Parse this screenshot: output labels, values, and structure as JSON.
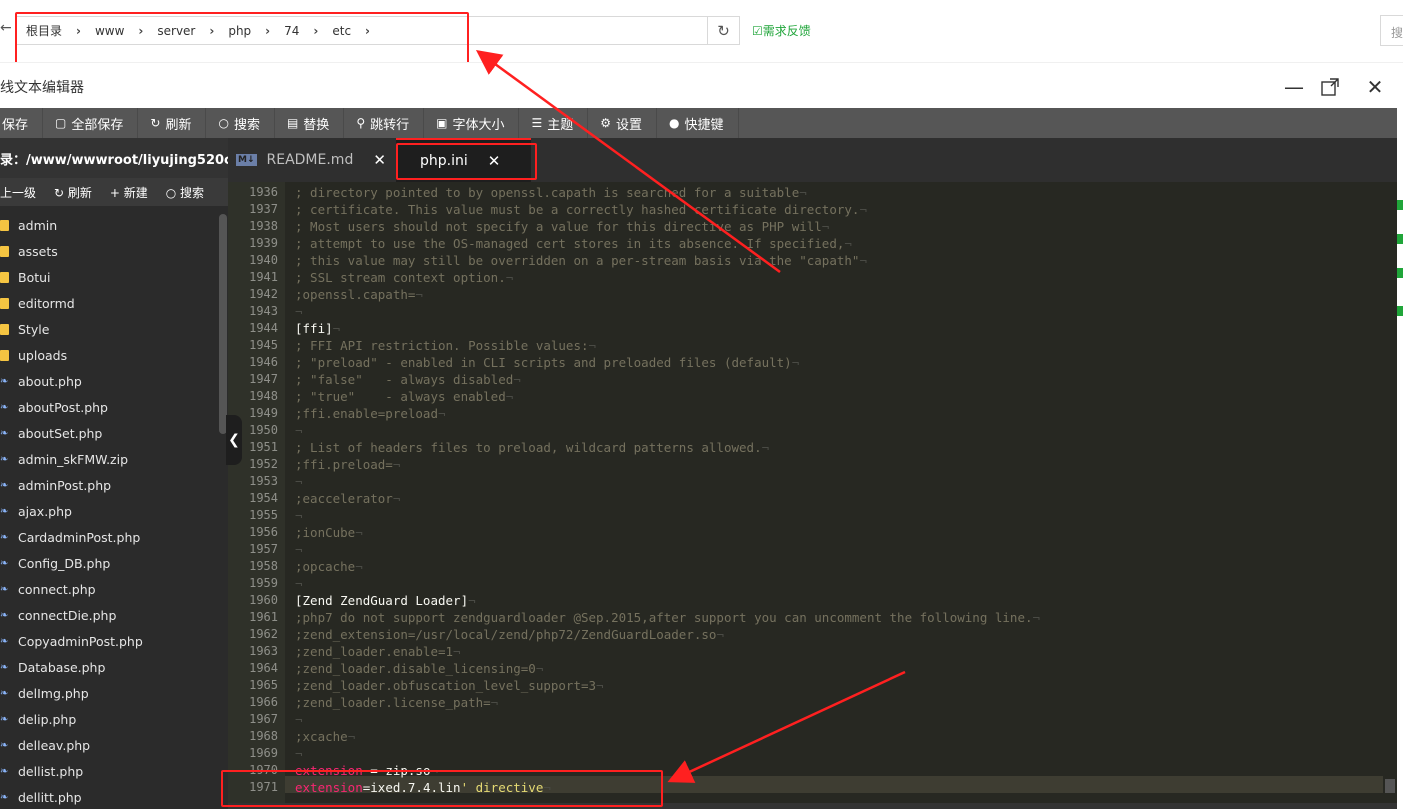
{
  "breadcrumb": [
    "根目录",
    "www",
    "server",
    "php",
    "74",
    "etc"
  ],
  "feedback_label": "需求反馈",
  "search_placeholder": "搜",
  "dialog_title": "线文本编辑器",
  "toolbar": [
    {
      "icon": "save-icon",
      "label": "保存"
    },
    {
      "icon": "save-all-icon",
      "label": "全部保存"
    },
    {
      "icon": "refresh-icon",
      "label": "刷新"
    },
    {
      "icon": "search-icon",
      "label": "搜索"
    },
    {
      "icon": "replace-icon",
      "label": "替换"
    },
    {
      "icon": "goto-line-icon",
      "label": "跳转行"
    },
    {
      "icon": "font-size-icon",
      "label": "字体大小"
    },
    {
      "icon": "theme-icon",
      "label": "主题"
    },
    {
      "icon": "settings-icon",
      "label": "设置"
    },
    {
      "icon": "shortcut-icon",
      "label": "快捷键"
    }
  ],
  "file_panel": {
    "dir_label": "录：/www/wwwroot/liyujing520c...",
    "actions": [
      "上一级",
      "刷新",
      "新建",
      "搜索"
    ],
    "files": [
      {
        "name": "admin",
        "type": "folder"
      },
      {
        "name": "assets",
        "type": "folder"
      },
      {
        "name": "Botui",
        "type": "folder"
      },
      {
        "name": "editormd",
        "type": "folder"
      },
      {
        "name": "Style",
        "type": "folder"
      },
      {
        "name": "uploads",
        "type": "folder"
      },
      {
        "name": "about.php",
        "type": "file"
      },
      {
        "name": "aboutPost.php",
        "type": "file"
      },
      {
        "name": "aboutSet.php",
        "type": "file"
      },
      {
        "name": "admin_skFMW.zip",
        "type": "file"
      },
      {
        "name": "adminPost.php",
        "type": "file"
      },
      {
        "name": "ajax.php",
        "type": "file"
      },
      {
        "name": "CardadminPost.php",
        "type": "file"
      },
      {
        "name": "Config_DB.php",
        "type": "file"
      },
      {
        "name": "connect.php",
        "type": "file"
      },
      {
        "name": "connectDie.php",
        "type": "file"
      },
      {
        "name": "CopyadminPost.php",
        "type": "file"
      },
      {
        "name": "Database.php",
        "type": "file"
      },
      {
        "name": "delImg.php",
        "type": "file"
      },
      {
        "name": "delip.php",
        "type": "file"
      },
      {
        "name": "delleav.php",
        "type": "file"
      },
      {
        "name": "dellist.php",
        "type": "file"
      },
      {
        "name": "dellitt.php",
        "type": "file"
      }
    ]
  },
  "tabs": [
    {
      "label": "README.md",
      "active": false
    },
    {
      "label": "php.ini",
      "active": true
    }
  ],
  "code_lines": [
    {
      "n": "1936",
      "t": "; directory pointed to by openssl.capath is searched for a suitable",
      "k": "comment"
    },
    {
      "n": "1937",
      "t": "; certificate. This value must be a correctly hashed certificate directory.",
      "k": "comment"
    },
    {
      "n": "1938",
      "t": "; Most users should not specify a value for this directive as PHP will",
      "k": "comment"
    },
    {
      "n": "1939",
      "t": "; attempt to use the OS-managed cert stores in its absence. If specified,",
      "k": "comment"
    },
    {
      "n": "1940",
      "t": "; this value may still be overridden on a per-stream basis via the \"capath\"",
      "k": "comment"
    },
    {
      "n": "1941",
      "t": "; SSL stream context option.",
      "k": "comment"
    },
    {
      "n": "1942",
      "t": ";openssl.capath=",
      "k": "comment"
    },
    {
      "n": "1943",
      "t": "",
      "k": "comment"
    },
    {
      "n": "1944",
      "t": "[ffi]",
      "k": "section"
    },
    {
      "n": "1945",
      "t": "; FFI API restriction. Possible values:",
      "k": "comment"
    },
    {
      "n": "1946",
      "t": "; \"preload\" - enabled in CLI scripts and preloaded files (default)",
      "k": "comment"
    },
    {
      "n": "1947",
      "t": "; \"false\"   - always disabled",
      "k": "comment"
    },
    {
      "n": "1948",
      "t": "; \"true\"    - always enabled",
      "k": "comment"
    },
    {
      "n": "1949",
      "t": ";ffi.enable=preload",
      "k": "comment"
    },
    {
      "n": "1950",
      "t": "",
      "k": "comment"
    },
    {
      "n": "1951",
      "t": "; List of headers files to preload, wildcard patterns allowed.",
      "k": "comment"
    },
    {
      "n": "1952",
      "t": ";ffi.preload=",
      "k": "comment"
    },
    {
      "n": "1953",
      "t": "",
      "k": "comment"
    },
    {
      "n": "1954",
      "t": ";eaccelerator",
      "k": "comment"
    },
    {
      "n": "1955",
      "t": "",
      "k": "comment"
    },
    {
      "n": "1956",
      "t": ";ionCube",
      "k": "comment"
    },
    {
      "n": "1957",
      "t": "",
      "k": "comment"
    },
    {
      "n": "1958",
      "t": ";opcache",
      "k": "comment"
    },
    {
      "n": "1959",
      "t": "",
      "k": "comment"
    },
    {
      "n": "1960",
      "t": "[Zend ZendGuard Loader]",
      "k": "section"
    },
    {
      "n": "1961",
      "t": ";php7 do not support zendguardloader @Sep.2015,after support you can uncomment the following line.",
      "k": "comment"
    },
    {
      "n": "1962",
      "t": ";zend_extension=/usr/local/zend/php72/ZendGuardLoader.so",
      "k": "comment"
    },
    {
      "n": "1963",
      "t": ";zend_loader.enable=1",
      "k": "comment"
    },
    {
      "n": "1964",
      "t": ";zend_loader.disable_licensing=0",
      "k": "comment"
    },
    {
      "n": "1965",
      "t": ";zend_loader.obfuscation_level_support=3",
      "k": "comment"
    },
    {
      "n": "1966",
      "t": ";zend_loader.license_path=",
      "k": "comment"
    },
    {
      "n": "1967",
      "t": "",
      "k": "comment"
    },
    {
      "n": "1968",
      "t": ";xcache",
      "k": "comment"
    },
    {
      "n": "1969",
      "t": "",
      "k": "comment"
    },
    {
      "n": "1970",
      "k": "ext",
      "key": "extension",
      "op": " = ",
      "val": "zip.so",
      "str": ""
    },
    {
      "n": "1971",
      "k": "ext",
      "key": "extension",
      "op": "=",
      "val": "ixed.7.4.lin",
      "str": "' directive"
    }
  ],
  "colors": {
    "annotation": "#ff2020",
    "accent_green": "#20a53a",
    "editor_bg": "#272822"
  }
}
